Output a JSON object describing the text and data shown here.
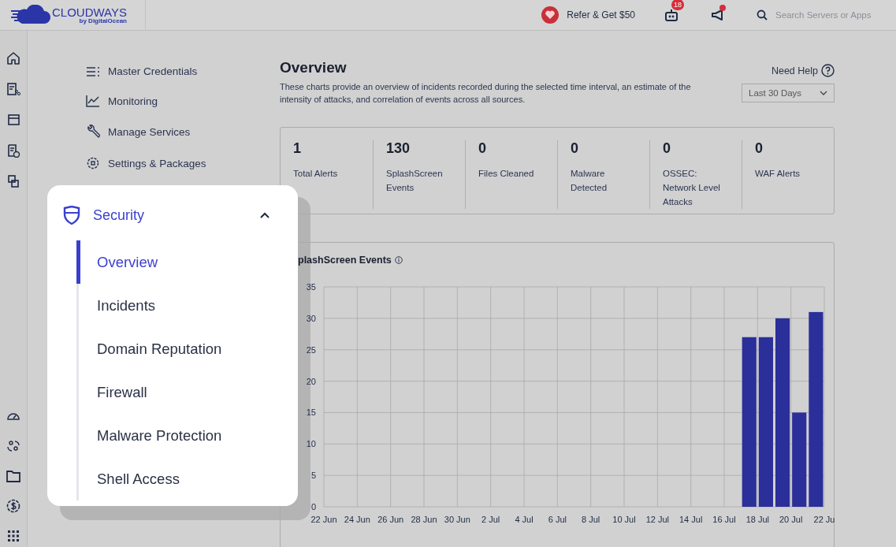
{
  "header": {
    "logo": {
      "name": "CLOUDWAYS",
      "tagline": "by DigitalOcean"
    },
    "refer": "Refer & Get $50",
    "bot_badge": "18",
    "announcements": {
      "unread": true
    },
    "search": {
      "placeholder": "Search Servers or Apps"
    }
  },
  "menu": [
    {
      "label": "Master Credentials",
      "kind": "list"
    },
    {
      "label": "Monitoring",
      "kind": "chart"
    },
    {
      "label": "Manage Services",
      "kind": "wrench"
    },
    {
      "label": "Settings & Packages",
      "kind": "gear"
    }
  ],
  "security": {
    "label": "Security",
    "expanded": true,
    "items": [
      {
        "label": "Overview",
        "selected": true
      },
      {
        "label": "Incidents",
        "selected": false
      },
      {
        "label": "Domain Reputation",
        "selected": false
      },
      {
        "label": "Firewall",
        "selected": false
      },
      {
        "label": "Malware Protection",
        "selected": false
      },
      {
        "label": "Shell Access",
        "selected": false
      }
    ]
  },
  "overview": {
    "title": "Overview",
    "description": "These charts provide an overview of incidents recorded during the selected time interval, an estimate of the intensity of attacks, and correlation of events across all sources.",
    "help": "Need Help",
    "range": "Last 30 Days"
  },
  "stats": [
    {
      "value": "1",
      "label": "Total Alerts"
    },
    {
      "value": "130",
      "label": "SplashScreen Events"
    },
    {
      "value": "0",
      "label": "Files Cleaned"
    },
    {
      "value": "0",
      "label": "Malware Detected"
    },
    {
      "value": "0",
      "label": "OSSEC: Network Level Attacks"
    },
    {
      "value": "0",
      "label": "WAF Alerts"
    }
  ],
  "chart": {
    "title": "plashScreen Events",
    "chart_data": {
      "type": "bar",
      "categories": [
        "22 Jun",
        null,
        "24 Jun",
        null,
        "26 Jun",
        null,
        "28 Jun",
        null,
        "30 Jun",
        null,
        "2 Jul",
        null,
        "4 Jul",
        null,
        "6 Jul",
        null,
        "8 Jul",
        null,
        "10 Jul",
        null,
        "12 Jul",
        null,
        "14 Jul",
        null,
        "16 Jul",
        null,
        "18 Jul",
        null,
        "20 Jul",
        null,
        "22 Ju"
      ],
      "series": [
        {
          "color": "#2a2f9a",
          "values": [
            0,
            0,
            0,
            0,
            0,
            0,
            0,
            0,
            0,
            0,
            0,
            0,
            0,
            0,
            0,
            0,
            0,
            0,
            0,
            0,
            0,
            0,
            0,
            0,
            0,
            0,
            27,
            27,
            30,
            15,
            31
          ]
        }
      ],
      "grid": true,
      "ylim": [
        0,
        35
      ],
      "yticks": [
        0,
        5,
        10,
        15,
        20,
        25,
        30,
        35
      ]
    }
  }
}
